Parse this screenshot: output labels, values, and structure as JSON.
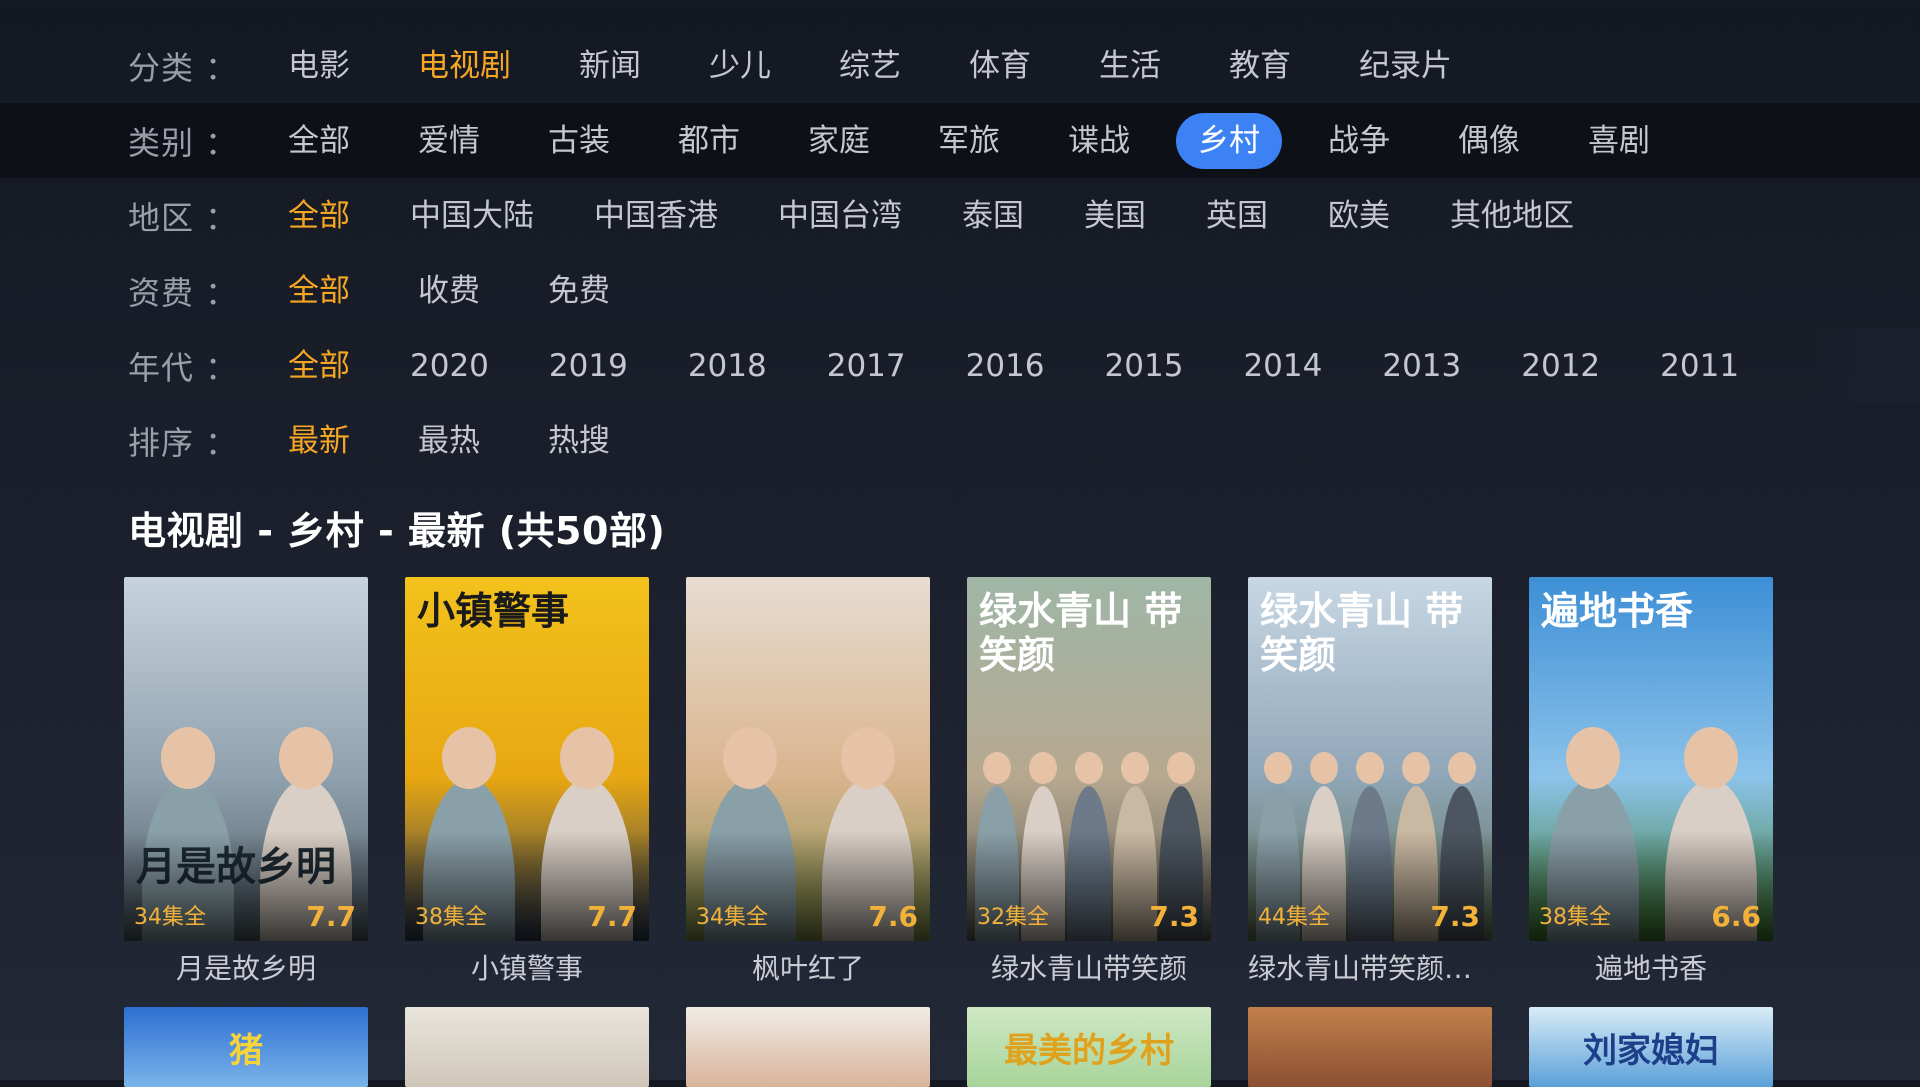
{
  "filters": [
    {
      "label": "分类 ：",
      "options": [
        "电影",
        "电视剧",
        "新闻",
        "少儿",
        "综艺",
        "体育",
        "生活",
        "教育",
        "纪录片"
      ],
      "selected": 1
    },
    {
      "label": "类别 ：",
      "options": [
        "全部",
        "爱情",
        "古装",
        "都市",
        "家庭",
        "军旅",
        "谍战",
        "乡村",
        "战争",
        "偶像",
        "喜剧"
      ],
      "focused": 7
    },
    {
      "label": "地区 ：",
      "options": [
        "全部",
        "中国大陆",
        "中国香港",
        "中国台湾",
        "泰国",
        "美国",
        "英国",
        "欧美",
        "其他地区"
      ],
      "selected": 0
    },
    {
      "label": "资费 ：",
      "options": [
        "全部",
        "收费",
        "免费"
      ],
      "selected": 0
    },
    {
      "label": "年代 ：",
      "options": [
        "全部",
        "2020",
        "2019",
        "2018",
        "2017",
        "2016",
        "2015",
        "2014",
        "2013",
        "2012",
        "2011"
      ],
      "selected": 0
    },
    {
      "label": "排序 ：",
      "options": [
        "最新",
        "最热",
        "热搜"
      ],
      "selected": 0
    }
  ],
  "section_title": "电视剧 - 乡村 - 最新 (共50部)",
  "cards": [
    {
      "name": "月是故乡明",
      "episodes": "34集全",
      "score": "7.7",
      "poster_text": "月是故乡明",
      "colors": [
        "#c7d3dc",
        "#8fa1ae",
        "#4d5a63"
      ],
      "text_color": "#1d2a33"
    },
    {
      "name": "小镇警事",
      "episodes": "38集全",
      "score": "7.7",
      "poster_text": "小镇警事",
      "colors": [
        "#f2c21b",
        "#e8a712",
        "#2c3a52"
      ],
      "text_color": "#1a1a1a"
    },
    {
      "name": "枫叶红了",
      "episodes": "34集全",
      "score": "7.6",
      "poster_text": "",
      "colors": [
        "#e7ddd1",
        "#d9b48e",
        "#7e8c46"
      ],
      "text_color": "#b33"
    },
    {
      "name": "绿水青山带笑颜",
      "episodes": "32集全",
      "score": "7.3",
      "poster_text": "绿水青山 带笑颜",
      "colors": [
        "#9fb6a6",
        "#b7a890",
        "#5a5c52"
      ],
      "text_color": "#ffffff"
    },
    {
      "name": "绿水青山带笑颜D...",
      "episodes": "44集全",
      "score": "7.3",
      "poster_text": "绿水青山 带笑颜",
      "colors": [
        "#c8d7e4",
        "#8fa6b8",
        "#5c6e52"
      ],
      "text_color": "#ffffff"
    },
    {
      "name": "遍地书香",
      "episodes": "38集全",
      "score": "6.6",
      "poster_text": "遍地书香",
      "colors": [
        "#3d8fd6",
        "#8cc3ea",
        "#3c7a2a"
      ],
      "text_color": "#ffffff"
    }
  ],
  "bottom_cards": [
    {
      "colors": [
        "#2d6fd1",
        "#7ab4ea"
      ],
      "poster_text": "猪"
    },
    {
      "colors": [
        "#e9e5dd",
        "#cfc6b8"
      ],
      "poster_text": ""
    },
    {
      "colors": [
        "#f1ece6",
        "#d8b39a"
      ],
      "poster_text": ""
    },
    {
      "colors": [
        "#cfe8c4",
        "#a7d49a"
      ],
      "poster_text": "最美的乡村"
    },
    {
      "colors": [
        "#c2804c",
        "#8a5032"
      ],
      "poster_text": ""
    },
    {
      "colors": [
        "#d9ecf7",
        "#5aa0d8"
      ],
      "poster_text": "刘家媳妇"
    }
  ]
}
